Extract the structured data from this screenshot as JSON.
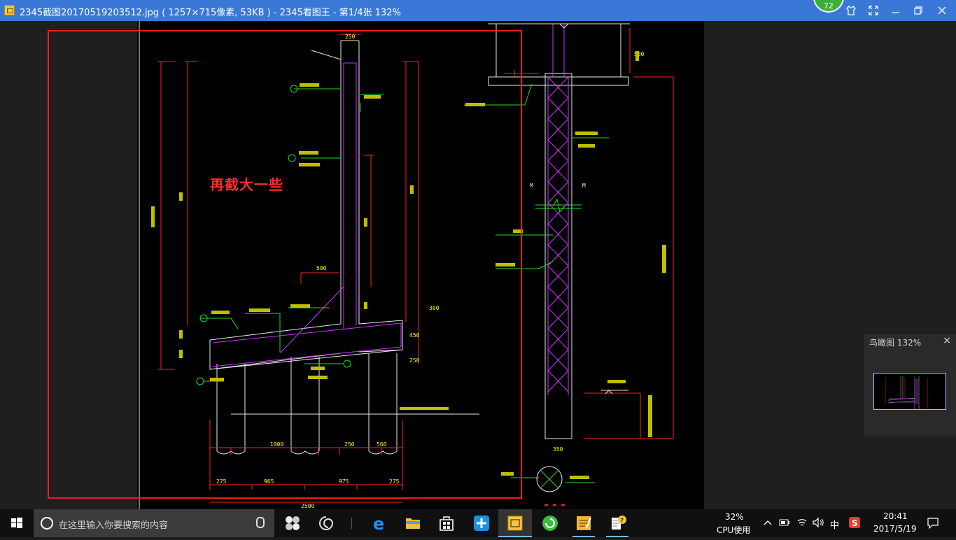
{
  "window": {
    "title": "2345截图20170519203512.jpg ( 1257×715像素, 53KB ) - 2345看图王 - 第1/4张 132%",
    "badge_count": "72",
    "buttons": [
      "skin",
      "fullscreen",
      "minimize",
      "maximize",
      "close"
    ]
  },
  "viewer": {
    "annotation_text": "再截大一些",
    "annotation_color": "#ff2a2a",
    "drawing": {
      "dims_top": [
        "250"
      ],
      "dims_bottom": [
        "1000",
        "250",
        "560",
        "275",
        "965",
        "975",
        "275",
        "2500"
      ],
      "dims_right": [
        "300",
        "500",
        "450",
        "250",
        "350",
        "500"
      ],
      "markers": [
        "M",
        "M"
      ]
    }
  },
  "bird_eye": {
    "title": "鸟瞰图 132%",
    "close": "×"
  },
  "taskbar": {
    "search_placeholder": "在这里输入你要搜索的内容",
    "apps": [
      "task-view",
      "browser-360",
      "edge",
      "file-explorer",
      "store",
      "qq-transfer",
      "2345-viewer",
      "360-safe",
      "notes",
      "help-doc"
    ],
    "cpu_percent": "32%",
    "cpu_label": "CPU使用",
    "ime": "中",
    "clock_time": "20:41",
    "clock_date": "2017/5/19"
  },
  "colors": {
    "titlebar": "#3a78d8",
    "cad_background": "#000000",
    "cad_yellow": "#ffff00",
    "cad_green": "#22dd22",
    "cad_magenta": "#cc33ff",
    "cad_red": "#ff2222",
    "cad_white": "#e8e8e8"
  }
}
